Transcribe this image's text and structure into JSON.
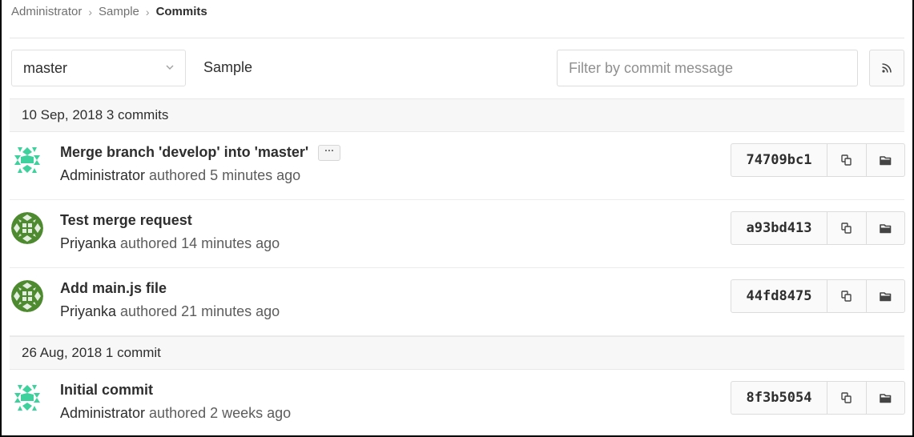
{
  "breadcrumb": {
    "items": [
      "Administrator",
      "Sample"
    ],
    "current": "Commits",
    "separator": "›"
  },
  "toolbar": {
    "branch": "master",
    "project": "Sample",
    "filter_placeholder": "Filter by commit message",
    "rss_icon": "rss-icon"
  },
  "groups": [
    {
      "header": "10 Sep, 2018 3 commits",
      "commits": [
        {
          "title": "Merge branch 'develop' into 'master'",
          "has_ellipsis": true,
          "ellipsis": "···",
          "author": "Administrator",
          "authored_text": "authored 5 minutes ago",
          "sha": "74709bc1",
          "avatar_style": "identicon-teal"
        },
        {
          "title": "Test merge request",
          "has_ellipsis": false,
          "author": "Priyanka",
          "authored_text": "authored 14 minutes ago",
          "sha": "a93bd413",
          "avatar_style": "identicon-green"
        },
        {
          "title": "Add main.js file",
          "has_ellipsis": false,
          "author": "Priyanka",
          "authored_text": "authored 21 minutes ago",
          "sha": "44fd8475",
          "avatar_style": "identicon-green"
        }
      ]
    },
    {
      "header": "26 Aug, 2018 1 commit",
      "commits": [
        {
          "title": "Initial commit",
          "has_ellipsis": false,
          "author": "Administrator",
          "authored_text": "authored 2 weeks ago",
          "sha": "8f3b5054",
          "avatar_style": "identicon-teal"
        }
      ]
    }
  ],
  "colors": {
    "teal_identicon": "#3ed19d",
    "green_identicon": "#4e8a2f"
  }
}
